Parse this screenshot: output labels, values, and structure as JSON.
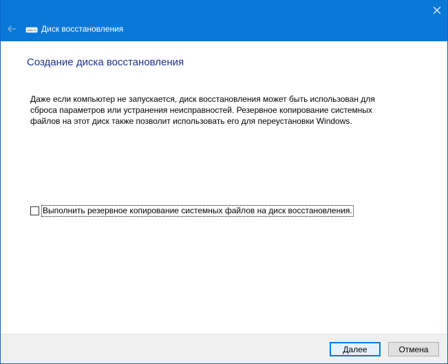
{
  "window": {
    "title": "Диск восстановления",
    "accent_color": "#0a78d7"
  },
  "titlebar": {
    "close_icon": "close-icon",
    "back_icon": "back-arrow-icon",
    "app_icon": "drive-icon"
  },
  "content": {
    "heading": "Создание диска восстановления",
    "description": "Даже если компьютер не запускается, диск восстановления может быть использован для сброса параметров или устранения неисправностей. Резервное копирование системных файлов на этот диск также позволит использовать его для переустановки Windows.",
    "backup_checkbox": {
      "label": "Выполнить резервное копирование системных файлов на диск восстановления.",
      "checked": false
    }
  },
  "footer": {
    "next_label": "Далее",
    "cancel_label": "Отмена"
  }
}
